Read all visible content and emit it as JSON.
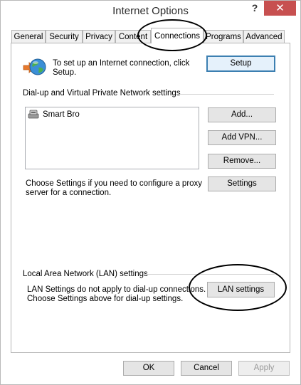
{
  "window": {
    "title": "Internet Options",
    "help_glyph": "?",
    "close_glyph": "✕"
  },
  "tabs": [
    {
      "label": "General"
    },
    {
      "label": "Security"
    },
    {
      "label": "Privacy"
    },
    {
      "label": "Content"
    },
    {
      "label": "Connections",
      "active": true
    },
    {
      "label": "Programs"
    },
    {
      "label": "Advanced"
    }
  ],
  "setup": {
    "text_line1": "To set up an Internet connection, click",
    "text_line2": "Setup.",
    "button_label": "Setup",
    "icon": "globe-network-icon"
  },
  "dialup": {
    "heading": "Dial-up and Virtual Private Network settings",
    "connections": [
      {
        "name": "Smart Bro",
        "icon": "dialup-connection-icon"
      }
    ],
    "add_label": "Add...",
    "add_vpn_label": "Add VPN...",
    "remove_label": "Remove...",
    "settings_label": "Settings",
    "proxy_text_line1": "Choose Settings if you need to configure a proxy",
    "proxy_text_line2": "server for a connection."
  },
  "lan": {
    "heading": "Local Area Network (LAN) settings",
    "text_line1": "LAN Settings do not apply to dial-up connections.",
    "text_line2": "Choose Settings above for dial-up settings.",
    "button_label": "LAN settings"
  },
  "footer": {
    "ok_label": "OK",
    "cancel_label": "Cancel",
    "apply_label": "Apply"
  },
  "colors": {
    "close_button": "#c75050",
    "default_button_border": "#3c7fb1"
  }
}
